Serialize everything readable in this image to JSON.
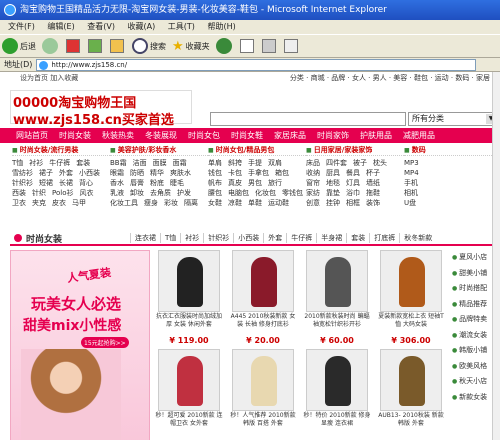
{
  "window": {
    "title": "淘宝购物王国精品活力无限-淘宝网女装-男装-化妆美容-鞋包 - Microsoft Internet Explorer"
  },
  "menu": [
    "文件(F)",
    "编辑(E)",
    "查看(V)",
    "收藏(A)",
    "工具(T)",
    "帮助(H)"
  ],
  "toolbar": {
    "back": "后退",
    "search": "搜索",
    "favorites": "收藏夹"
  },
  "address": {
    "label": "地址(D)",
    "url": "http://www.zjs158.cn/"
  },
  "toplinks": {
    "left": "设为首页  加入收藏",
    "right": "分类 · 商城 · 品牌 · 女人 · 男人 · 美容 · 鞋包 · 运动 · 数码 · 家居"
  },
  "logo": {
    "line1": "00000淘宝购物王国",
    "line2": "www.zjs158.cn买家首选"
  },
  "search": {
    "category": "所有分类"
  },
  "nav": [
    "网站首页",
    "时尚女装",
    "秋装热卖",
    "冬装展现",
    "时尚女包",
    "时尚女鞋",
    "家居床品",
    "时尚家饰",
    "护肤用品",
    "减肥用品"
  ],
  "categories": [
    {
      "head": "时尚女装/流行男装",
      "rows": [
        [
          "T恤",
          "衬衫",
          "牛仔裤",
          "套装"
        ],
        [
          "雪纺衫",
          "裙子",
          "外套",
          "小西装"
        ],
        [
          "针织衫",
          "短裙",
          "长裙",
          "背心"
        ],
        [
          "西装",
          "针织",
          "Polo衫",
          "风衣"
        ],
        [
          "卫衣",
          "夹克",
          "皮衣",
          "马甲"
        ]
      ]
    },
    {
      "head": "美容护肤/彩妆香水",
      "rows": [
        [
          "BB霜",
          "洁面",
          "面膜",
          "面霜"
        ],
        [
          "眼霜",
          "防晒",
          "精华",
          "爽肤水"
        ],
        [
          "香水",
          "唇膏",
          "粉底",
          "睫毛"
        ],
        [
          "乳液",
          "卸妆",
          "去角质",
          "护发"
        ],
        [
          "化妆工具",
          "瘦身",
          "彩妆",
          "隔离"
        ]
      ]
    },
    {
      "head": "时尚女包/精品男包",
      "rows": [
        [
          "单肩",
          "斜挎",
          "手提",
          "双肩"
        ],
        [
          "钱包",
          "卡包",
          "手拿包",
          "箱包"
        ],
        [
          "帆布",
          "真皮",
          "男包",
          "旅行"
        ],
        [
          "腰包",
          "电脑包",
          "化妆包",
          "零钱包"
        ],
        [
          "女鞋",
          "凉鞋",
          "单鞋",
          "运动鞋"
        ]
      ]
    },
    {
      "head": "日用家居/家装家饰",
      "rows": [
        [
          "床品",
          "四件套",
          "被子",
          "枕头"
        ],
        [
          "收纳",
          "厨具",
          "餐具",
          "杯子"
        ],
        [
          "窗帘",
          "地毯",
          "灯具",
          "墙纸"
        ],
        [
          "家纺",
          "靠垫",
          "浴巾",
          "拖鞋"
        ],
        [
          "创意",
          "挂钟",
          "相框",
          "装饰"
        ]
      ]
    },
    {
      "head": "数码",
      "rows": [
        [
          "MP3"
        ],
        [
          "MP4"
        ],
        [
          "手机"
        ],
        [
          "相机"
        ],
        [
          "U盘"
        ]
      ]
    }
  ],
  "section": {
    "title": "时尚女装",
    "tabs": [
      "连衣裙",
      "T恤",
      "衬衫",
      "针织衫",
      "小西装",
      "外套",
      "牛仔裤",
      "半身裙",
      "套装",
      "打底裤",
      "秋冬新款"
    ]
  },
  "banner": {
    "line1": "人气夏装",
    "line2": "玩美女人必选",
    "line3": "甜美mix小性感",
    "button": "15元起抢购>>"
  },
  "products": [
    {
      "title": "抗衣汇衣服装时尚加绒加厚 女装 休闲外套",
      "price": "¥ 119.00",
      "color": "#222"
    },
    {
      "title": "A445 2010秋装新款 女装 长袖 修身打底衫",
      "price": "¥ 20.00",
      "color": "#8a1a2a"
    },
    {
      "title": "2010新款秋装时尚 蝙蝠袖宽松针织衫开衫",
      "price": "¥ 60.00",
      "color": "#555"
    },
    {
      "title": "夏装新款宽松上衣 短袖T恤 大码女装",
      "price": "¥ 306.00",
      "color": "#b05a1a"
    },
    {
      "title": "秒！超可爱 2010新款 连帽卫衣 女外套",
      "price": "",
      "color": "#c03040"
    },
    {
      "title": "秒！人气推荐 2010新款 韩版 百搭 外套",
      "price": "",
      "color": "#e8d8b0"
    },
    {
      "title": "秒！特价 2010新款 修身显瘦 连衣裙",
      "price": "",
      "color": "#2a2a2a"
    },
    {
      "title": "AUB13- 2010秋装 新款 韩版 外套",
      "price": "",
      "color": "#7a5a2a"
    }
  ],
  "sidebar": [
    "夏风小店",
    "甜美小铺",
    "时尚搭配",
    "精品推荐",
    "品牌特卖",
    "潮流女装",
    "韩版小铺",
    "欧美风格",
    "秋天小店",
    "新款女装"
  ]
}
